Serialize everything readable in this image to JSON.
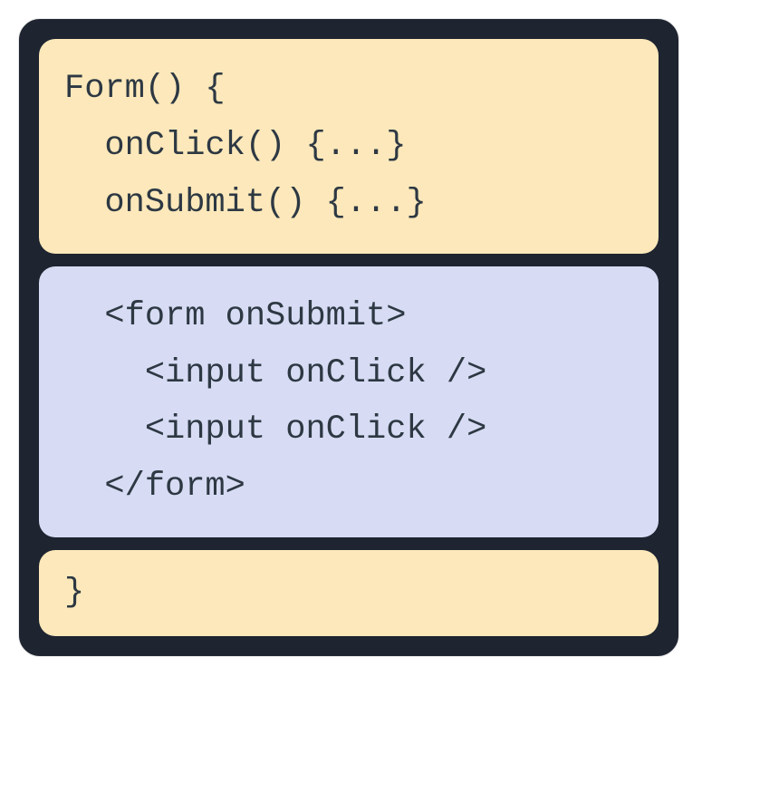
{
  "blocks": {
    "top": {
      "line1": "Form() {",
      "line2": "  onClick() {...}",
      "line3": "  onSubmit() {...}"
    },
    "middle": {
      "line1": "  <form onSubmit>",
      "line2": "    <input onClick />",
      "line3": "    <input onClick />",
      "line4": "  </form>"
    },
    "bottom": {
      "line1": "}"
    }
  }
}
